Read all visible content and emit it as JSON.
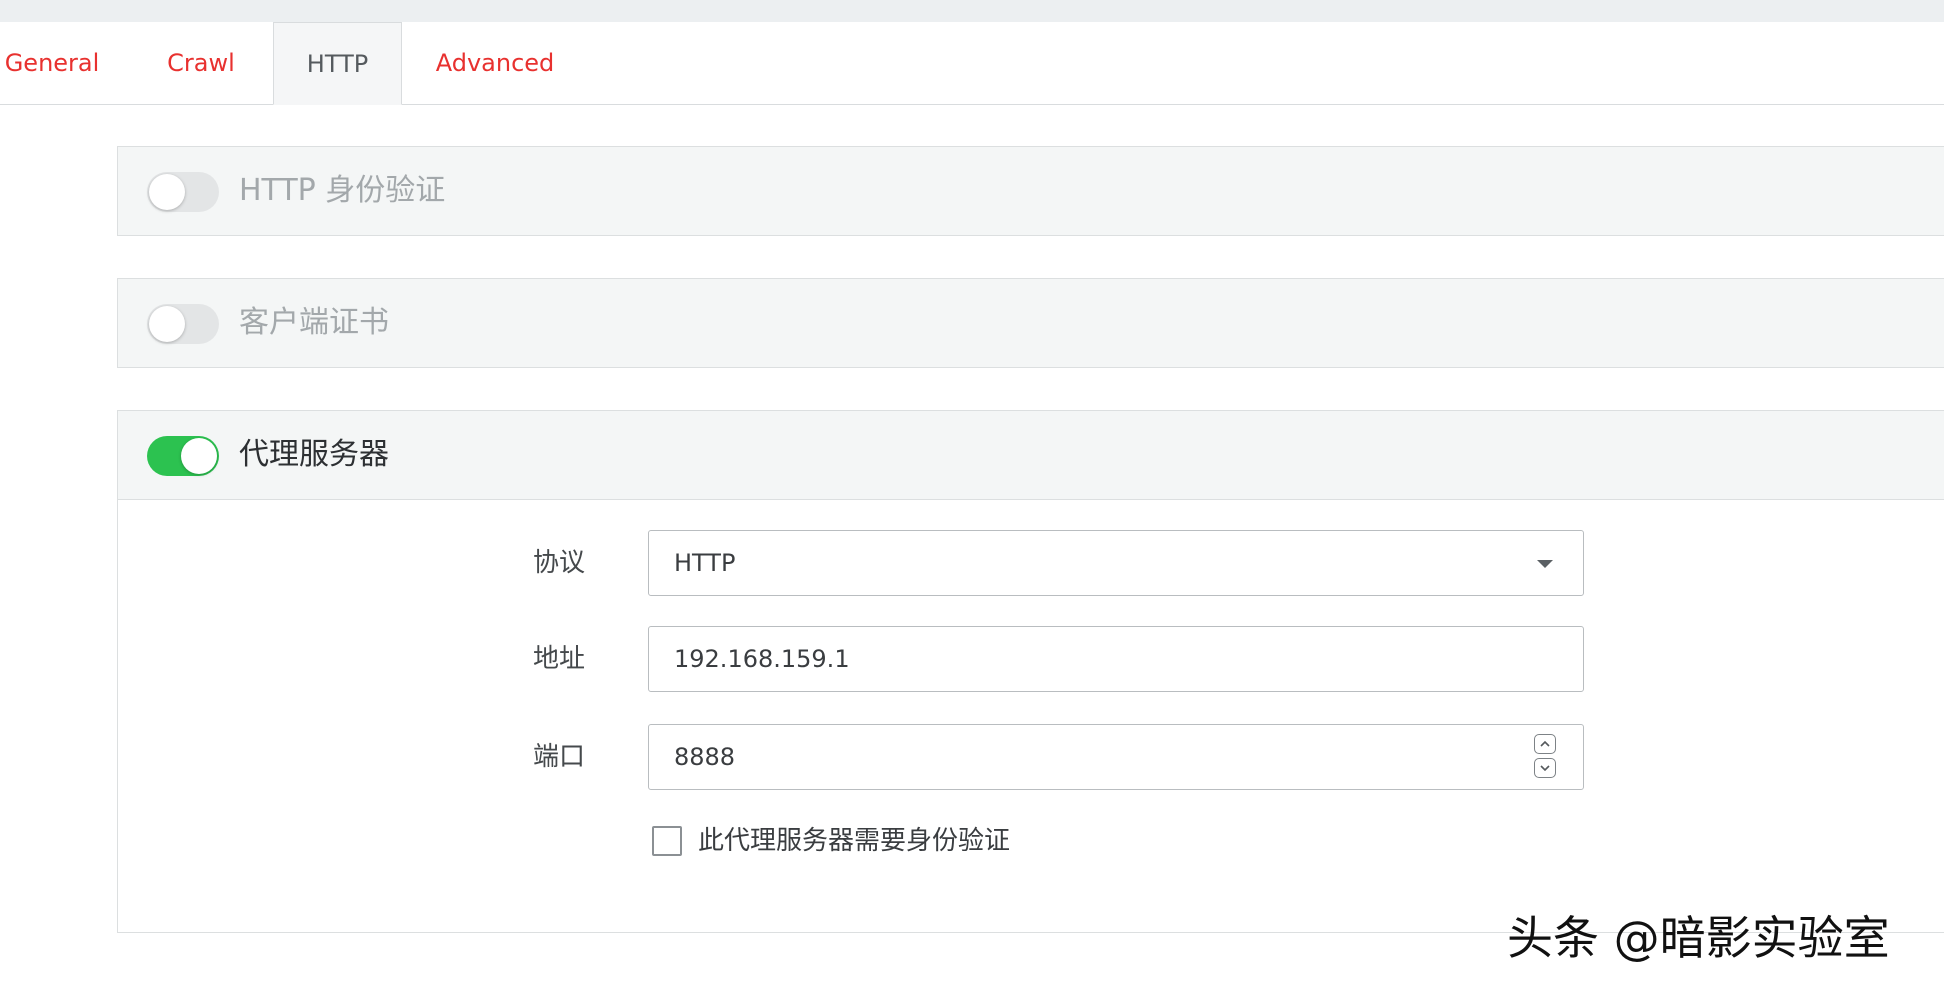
{
  "tabs": [
    {
      "label": "General",
      "active": false
    },
    {
      "label": "Crawl",
      "active": false
    },
    {
      "label": "HTTP",
      "active": true
    },
    {
      "label": "Advanced",
      "active": false
    }
  ],
  "panels": {
    "http_auth": {
      "title": "HTTP 身份验证",
      "enabled": false
    },
    "client_cert": {
      "title": "客户端证书",
      "enabled": false
    },
    "proxy": {
      "title": "代理服务器",
      "enabled": true,
      "protocol_label": "协议",
      "protocol_value": "HTTP",
      "address_label": "地址",
      "address_value": "192.168.159.1",
      "port_label": "端口",
      "port_value": "8888",
      "auth_checkbox_label": "此代理服务器需要身份验证",
      "auth_checkbox_checked": false
    }
  },
  "watermark": "头条 @暗影实验室",
  "colors": {
    "tab_link": "#e8312f",
    "toggle_on": "#2cc250",
    "toggle_off": "#e3e5e6"
  },
  "icons": {
    "select": "caret-down-icon",
    "port_up": "chevron-up-icon",
    "port_down": "chevron-down-icon"
  }
}
